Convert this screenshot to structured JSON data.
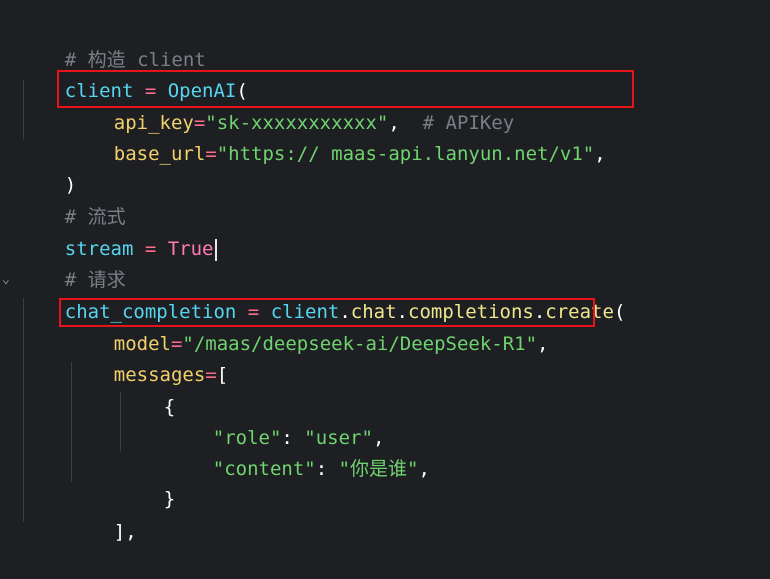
{
  "code": {
    "l1_comment": "# 构造 client",
    "l2_var": "client",
    "l2_eq": " = ",
    "l2_fn": "OpenAI",
    "l2_paren": "(",
    "l3_param": "api_key",
    "l3_eq": "=",
    "l3_str": "\"sk-xxxxxxxxxxx\"",
    "l3_comma": ",",
    "l3_comment": "  # APIKey",
    "l4_param": "base_url",
    "l4_eq": "=",
    "l4_str": "\"https:// maas-api.lanyun.net/v1\"",
    "l4_comma": ",",
    "l5_paren": ")",
    "l6_comment": "# 流式",
    "l7_var": "stream",
    "l7_eq": " = ",
    "l7_kw": "True",
    "l8_comment": "# 请求",
    "l9_var": "chat_completion",
    "l9_eq": " = ",
    "l9_obj": "client",
    "l9_dot1": ".",
    "l9_chat": "chat",
    "l9_dot2": ".",
    "l9_completions": "completions",
    "l9_dot3": ".",
    "l9_create": "create",
    "l9_paren": "(",
    "l10_param": "model",
    "l10_eq": "=",
    "l10_str": "\"/maas/deepseek-ai/DeepSeek-R1\"",
    "l10_comma": ",",
    "l11_param": "messages",
    "l11_eq": "=",
    "l11_bracket": "[",
    "l12_brace": "{",
    "l13_key": "\"role\"",
    "l13_colon": ": ",
    "l13_val": "\"user\"",
    "l13_comma": ",",
    "l14_key": "\"content\"",
    "l14_colon": ": ",
    "l14_val": "\"你是谁\"",
    "l14_comma": ",",
    "l15_brace": "}",
    "l16_close": "],"
  },
  "colors": {
    "background": "#1e1f22",
    "highlight_box": "#e8141c"
  }
}
